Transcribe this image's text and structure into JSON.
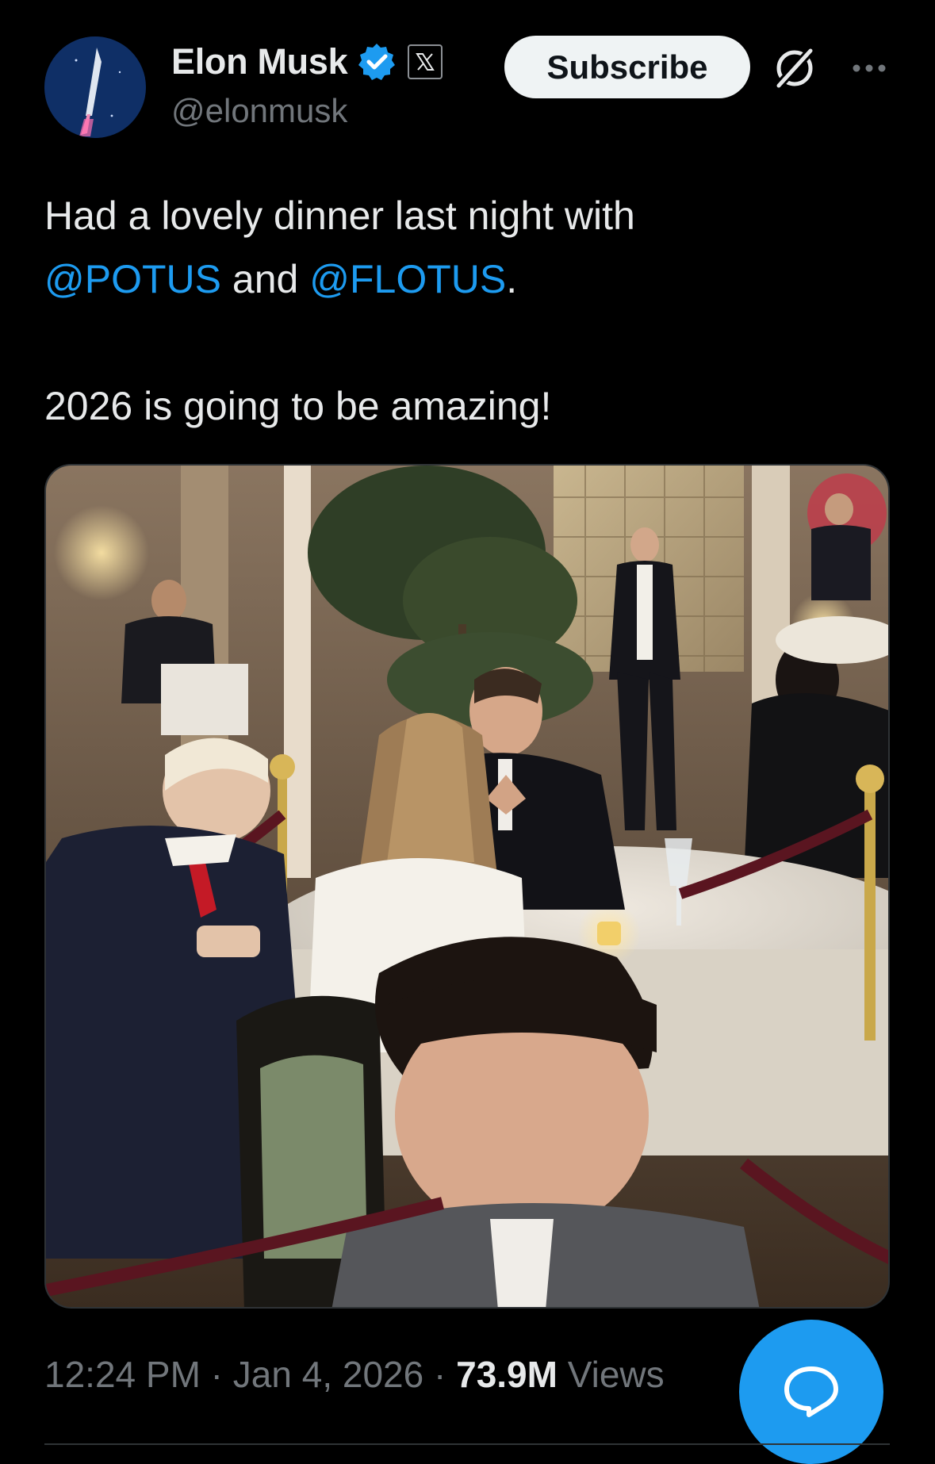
{
  "author": {
    "display_name": "Elon Musk",
    "handle": "@elonmusk",
    "avatar_icon": "rocket-avatar",
    "verified_icon": "verified-badge-icon",
    "affiliate_icon": "x-logo-icon"
  },
  "header": {
    "subscribe_label": "Subscribe",
    "grok_icon": "grok-icon",
    "more_icon": "more-options-icon"
  },
  "tweet": {
    "line1": "Had a lovely dinner last night with",
    "mention1": "@POTUS",
    "and_text": " and ",
    "mention2": "@FLOTUS",
    "period": ".",
    "line3": "2026 is going to be amazing!"
  },
  "media": {
    "type": "photo"
  },
  "meta": {
    "time": "12:24 PM",
    "sep1": " · ",
    "date": "Jan 4, 2026",
    "sep2": " · ",
    "views_count": "73.9M",
    "views_label": " Views"
  },
  "fab": {
    "icon": "reply-icon"
  },
  "colors": {
    "background": "#000000",
    "text": "#e7e9ea",
    "secondary": "#71767b",
    "accent": "#1d9bf0",
    "verified": "#1d9bf0"
  }
}
